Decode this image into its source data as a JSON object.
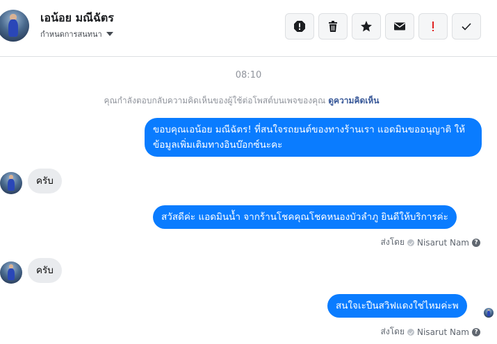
{
  "header": {
    "contact_name": "เอน้อย มณีฉัตร",
    "assign_label": "กำหนดการสนทนา",
    "actions": [
      "report",
      "delete",
      "star",
      "mail",
      "important",
      "done"
    ]
  },
  "thread": {
    "timestamp": "08:10",
    "notice_text": "คุณกำลังตอบกลับความคิดเห็นของผู้ใช้ต่อโพสต์บนเพจของคุณ",
    "notice_link": "ดูความคิดเห็น",
    "messages": [
      {
        "dir": "out",
        "text": "ขอบคุณเอน้อย มณีฉัตร! ที่สนใจรถยนต์ของทางร้านเรา แอดมินขออนุญาติ ให้ข้อมูลเพิ่มเติมทางอินบ๊อกซ์นะคะ"
      },
      {
        "dir": "in",
        "text": "ครับ"
      },
      {
        "dir": "out",
        "text": "สวัสดีค่ะ แอดมินน้ำ จากร้านโชคคุณโชคหนองบัวลำภู ยินดีให้บริการค่ะ",
        "sent_by_label": "ส่งโดย",
        "sent_by_name": "Nisarut Nam"
      },
      {
        "dir": "in",
        "text": "ครับ"
      },
      {
        "dir": "out",
        "text": "สนใจเะปืนสวิฟแดงใช่ไหมค่ะพ",
        "sent_by_label": "ส่งโดย",
        "sent_by_name": "Nisarut Nam"
      }
    ]
  },
  "colors": {
    "outgoing": "#0a7cff",
    "incoming": "#e9ebee",
    "link": "#385898",
    "important": "#e02020"
  }
}
